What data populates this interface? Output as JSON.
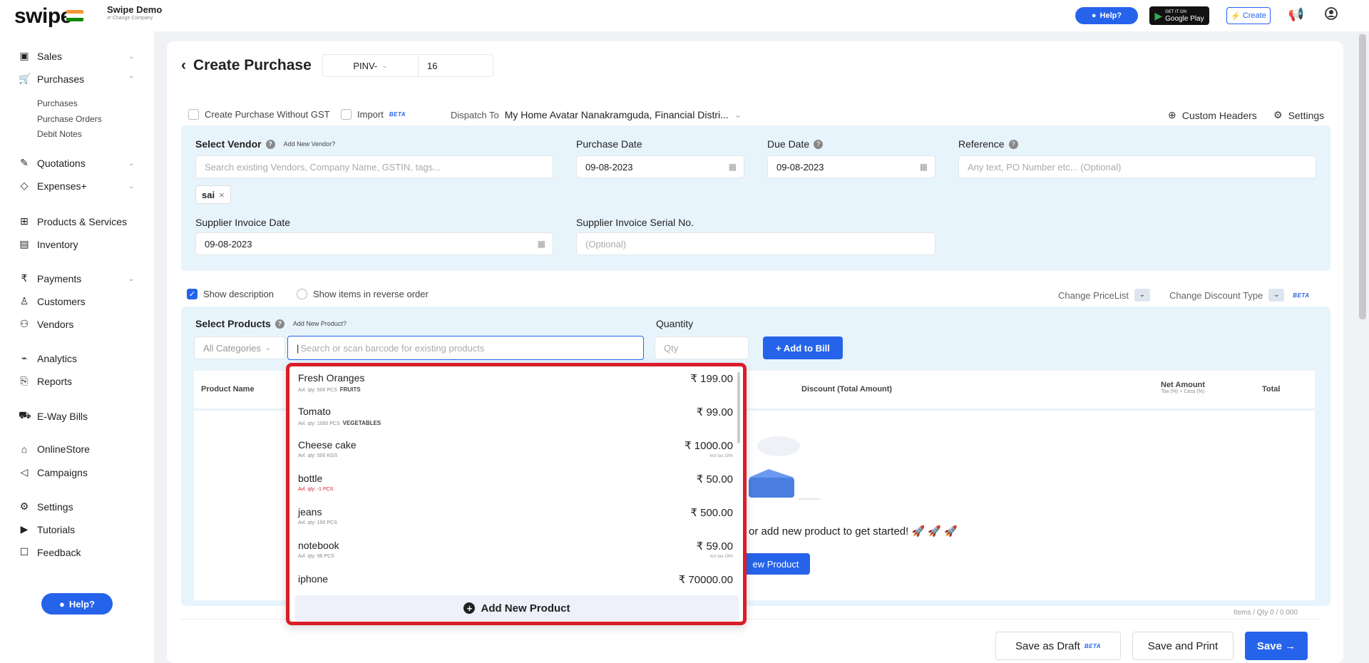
{
  "topbar": {
    "logo": "swipe",
    "company_name": "Swipe Demo",
    "company_sub": "⇄ Change Company",
    "help_label": "Help?",
    "gplay_small": "GET IT ON",
    "gplay_label": "Google Play",
    "create_label": "Create"
  },
  "sidebar": {
    "items": [
      {
        "label": "Sales",
        "icon": "sales-icon"
      },
      {
        "label": "Purchases",
        "icon": "cart-icon"
      },
      {
        "label": "Quotations",
        "icon": "pen-icon"
      },
      {
        "label": "Expenses+",
        "icon": "tag-icon"
      },
      {
        "label": "Products & Services",
        "icon": "box-icon"
      },
      {
        "label": "Inventory",
        "icon": "inventory-icon"
      },
      {
        "label": "Payments",
        "icon": "rupee-icon"
      },
      {
        "label": "Customers",
        "icon": "user-icon"
      },
      {
        "label": "Vendors",
        "icon": "users-icon"
      },
      {
        "label": "Analytics",
        "icon": "chart-icon"
      },
      {
        "label": "Reports",
        "icon": "report-icon"
      },
      {
        "label": "E-Way Bills",
        "icon": "truck-icon"
      },
      {
        "label": "OnlineStore",
        "icon": "store-icon"
      },
      {
        "label": "Campaigns",
        "icon": "megaphone-icon"
      },
      {
        "label": "Settings",
        "icon": "gear-icon"
      },
      {
        "label": "Tutorials",
        "icon": "youtube-icon"
      },
      {
        "label": "Feedback",
        "icon": "chat-icon"
      }
    ],
    "purchases_sub": [
      "Purchases",
      "Purchase Orders",
      "Debit Notes"
    ],
    "help_label": "Help?"
  },
  "header": {
    "title": "Create Purchase",
    "prefix": "PINV-",
    "number": "16"
  },
  "options": {
    "without_gst": "Create Purchase Without GST",
    "import": "Import",
    "beta": "BETA",
    "dispatch_label": "Dispatch To",
    "dispatch_value": "My Home Avatar Nanakramguda, Financial Distri...",
    "custom_headers": "Custom Headers",
    "settings": "Settings"
  },
  "form": {
    "vendor_label": "Select Vendor",
    "add_vendor": "Add New Vendor?",
    "vendor_placeholder": "Search existing Vendors, Company Name, GSTIN, tags...",
    "vendor_tag": "sai",
    "purchase_date_label": "Purchase Date",
    "purchase_date": "09-08-2023",
    "due_date_label": "Due Date",
    "due_date": "09-08-2023",
    "reference_label": "Reference",
    "reference_placeholder": "Any text, PO Number etc... (Optional)",
    "supplier_date_label": "Supplier Invoice Date",
    "supplier_date": "09-08-2023",
    "supplier_serial_label": "Supplier Invoice Serial No.",
    "supplier_serial_placeholder": "(Optional)"
  },
  "items_opts": {
    "show_description": "Show description",
    "reverse_order": "Show items in reverse order",
    "change_pricelist": "Change PriceList",
    "change_discount": "Change Discount Type",
    "beta": "BETA"
  },
  "products": {
    "select_label": "Select Products",
    "add_product_link": "Add New Product?",
    "categories": "All Categories",
    "search_placeholder": "Search or scan barcode for existing products",
    "quantity_label": "Quantity",
    "qty_placeholder": "Qty",
    "add_to_bill": "+ Add to Bill"
  },
  "table": {
    "product_name": "Product Name",
    "discount": "Discount (Total Amount)",
    "net_amount": "Net Amount",
    "net_sub": "Tax (%) + Cess (%)",
    "total": "Total",
    "empty_msg": "or add new product to get started! 🚀 🚀 🚀",
    "new_product_btn": "ew Product",
    "items_qty": "Items / Qty 0 / 0.000"
  },
  "dropdown": {
    "items": [
      {
        "name": "Fresh Oranges",
        "meta": "Avl. qty: 500  PCS",
        "cat": "FRUITS",
        "price": "₹ 199.00",
        "tax": ""
      },
      {
        "name": "Tomato",
        "meta": "Avl. qty: 1000  PCS",
        "cat": "VEGETABLES",
        "price": "₹ 99.00",
        "tax": ""
      },
      {
        "name": "Cheese cake",
        "meta": "Avl. qty: 500  KGS",
        "cat": "",
        "price": "₹ 1000.00",
        "tax": "incl tax 18%"
      },
      {
        "name": "bottle",
        "meta": "Avl. qty: -1  PCS",
        "cat": "",
        "price": "₹ 50.00",
        "tax": ""
      },
      {
        "name": "jeans",
        "meta": "Avl. qty: 100  PCS",
        "cat": "",
        "price": "₹ 500.00",
        "tax": ""
      },
      {
        "name": "notebook",
        "meta": "Avl. qty: 96  PCS",
        "cat": "",
        "price": "₹ 59.00",
        "tax": "incl tax 18%"
      },
      {
        "name": "iphone",
        "meta": "",
        "cat": "",
        "price": "₹ 70000.00",
        "tax": ""
      }
    ],
    "add_new": "Add New Product"
  },
  "footer": {
    "save_draft": "Save as Draft",
    "beta": "BETA",
    "save_print": "Save and Print",
    "save": "Save →"
  },
  "colors": {
    "accent": "#2563eb",
    "highlight": "#d91e2a",
    "panel": "#e8f4fc"
  }
}
